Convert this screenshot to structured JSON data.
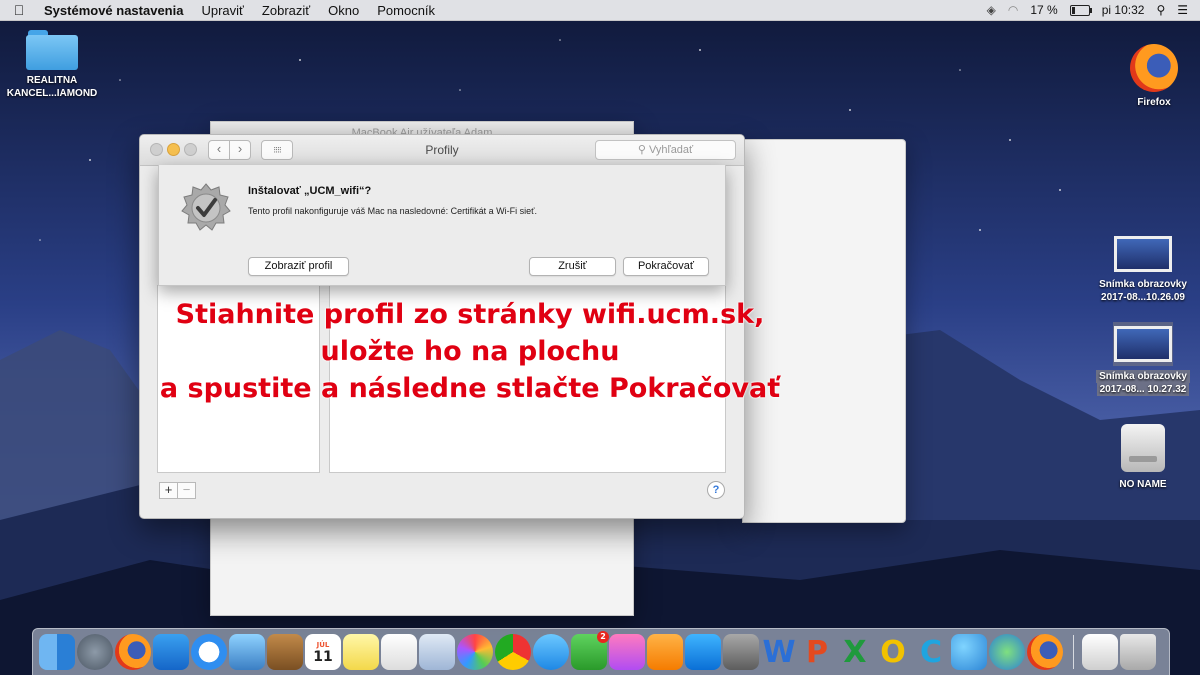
{
  "menubar": {
    "apple_icon": "apple-icon",
    "app_name": "Systémové nastavenia",
    "menus": [
      "Upraviť",
      "Zobraziť",
      "Okno",
      "Pomocník"
    ],
    "battery_percent": "17 %",
    "battery_level": 0.17,
    "clock": "pi 10:32"
  },
  "desktop": {
    "folder_label_line1": "REALITNA",
    "folder_label_line2": "KANCEL...IAMOND",
    "firefox_label": "Firefox",
    "screenshot1_line1": "Snímka obrazovky",
    "screenshot1_line2": "2017-08...10.26.09",
    "screenshot2_line1": "Snímka obrazovky",
    "screenshot2_line2": "2017-08... 10.27.32",
    "disk_label": "NO NAME"
  },
  "bg_window": {
    "title": "MacBook Air užívateľa Adam"
  },
  "prefs": {
    "title": "Profily",
    "search_placeholder": "Vyhľadať",
    "nav_back": "‹",
    "nav_forward": "›",
    "grid_icon": "⁝⁝⁝⁝",
    "add": "+",
    "remove": "−",
    "help": "?"
  },
  "sheet": {
    "title": "Inštalovať „UCM_wifi“?",
    "message": "Tento profil nakonfiguruje váš Mac na nasledovné: Certifikát a Wi-Fi sieť.",
    "show_profile": "Zobraziť profil",
    "cancel": "Zrušiť",
    "continue": "Pokračovať"
  },
  "caption": {
    "line1": "Stiahnite profil zo stránky wifi.ucm.sk,",
    "line2": "uložte ho na plochu",
    "line3": "a spustite a následne stlačte Pokračovať"
  },
  "dock": {
    "calendar_month": "JÚL",
    "calendar_day": "11",
    "facetime_badge": "2",
    "word_letter": "W",
    "powerpoint_letter": "P",
    "excel_letter": "X",
    "outlook_letter": "O",
    "c_letter": "C"
  }
}
